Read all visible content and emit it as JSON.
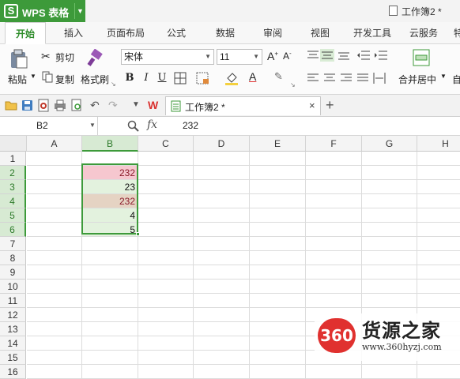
{
  "app": {
    "brand": "WPS 表格",
    "brand_logo": "S",
    "document_title": "工作簿2 *"
  },
  "ribbon_tabs": [
    "开始",
    "插入",
    "页面布局",
    "公式",
    "数据",
    "审阅",
    "视图",
    "开发工具",
    "云服务",
    "特"
  ],
  "ribbon": {
    "paste": "粘贴",
    "cut": "剪切",
    "copy": "复制",
    "format_painter": "格式刷",
    "font_name": "宋体",
    "font_size": "11",
    "bold": "B",
    "italic": "I",
    "underline": "U",
    "merge_center": "合并居中",
    "auto_wrap": "自"
  },
  "quick_access": {
    "doc_tab_label": "工作簿2 *",
    "close": "×",
    "new_tab": "+"
  },
  "formula_bar": {
    "name_box": "B2",
    "fx": "fx",
    "value": "232"
  },
  "sheet": {
    "columns": [
      "A",
      "B",
      "C",
      "D",
      "E",
      "F",
      "G",
      "H"
    ],
    "rows": [
      "1",
      "2",
      "3",
      "4",
      "5",
      "6",
      "7",
      "8",
      "9",
      "10",
      "11",
      "12",
      "13",
      "14",
      "15",
      "16"
    ],
    "selected_column": "B",
    "selected_rows": [
      "2",
      "3",
      "4",
      "5",
      "6"
    ],
    "cells": [
      {
        "ref": "B2",
        "value": "232",
        "bg": "#f6c7cf",
        "color": "#8a1a2a"
      },
      {
        "ref": "B3",
        "value": "23",
        "bg": "#e3f2de",
        "color": "#111111"
      },
      {
        "ref": "B4",
        "value": "232",
        "bg": "#e5d3c3",
        "color": "#8a1a2a"
      },
      {
        "ref": "B5",
        "value": "4",
        "bg": "#e3f2de",
        "color": "#111111"
      },
      {
        "ref": "B6",
        "value": "5",
        "bg": "#e3f2de",
        "color": "#111111"
      }
    ]
  },
  "watermark": {
    "badge": "360",
    "name": "货源之家",
    "url": "www.360hyzj.com"
  },
  "colors": {
    "brand_green": "#3d9a3a",
    "selection_green": "#3d9a3a",
    "header_selected": "#d7ead3",
    "watermark_red": "#e0312f"
  }
}
